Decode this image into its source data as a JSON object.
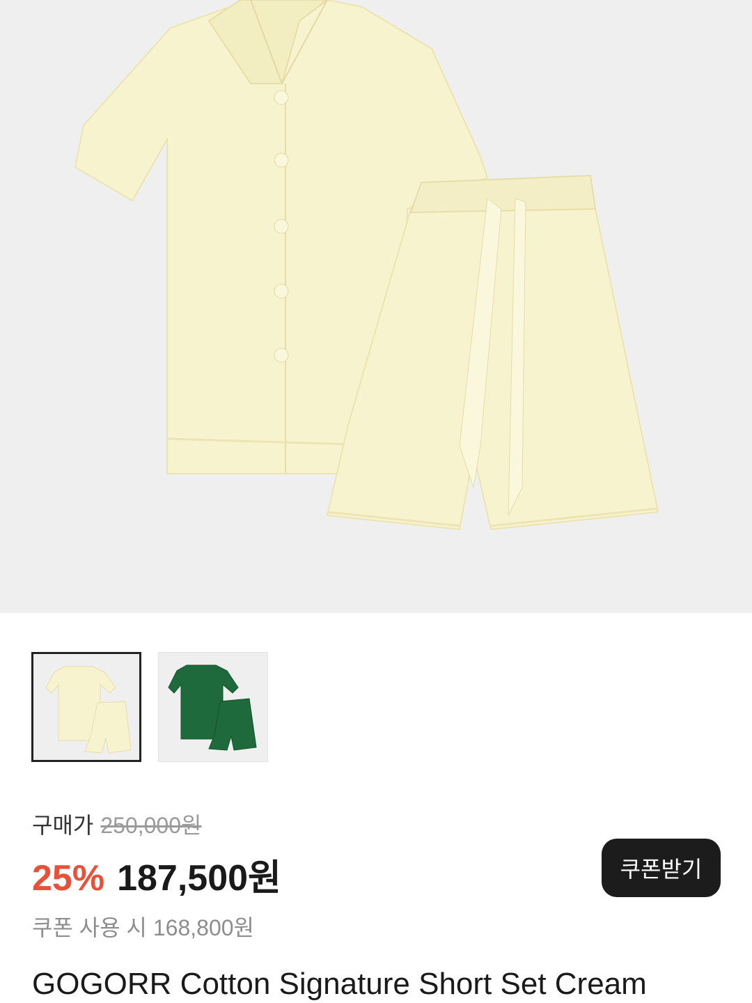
{
  "product": {
    "title": "GOGORR Cotton Signature Short Set Cream",
    "brand_mark": "GOGORR",
    "images": [
      {
        "name": "cream",
        "selected": true,
        "color": "#f8f3cf"
      },
      {
        "name": "green",
        "selected": false,
        "color": "#1e6a3c"
      }
    ]
  },
  "price": {
    "label": "구매가",
    "original": "250,000원",
    "discount": "25%",
    "sale": "187,500원",
    "coupon_text": "쿠폰 사용 시 168,800원"
  },
  "coupon_button": {
    "label": "쿠폰받기"
  },
  "colors": {
    "discount": "#e8503a",
    "button_bg": "#1c1c1c",
    "hero_bg": "#efefef"
  }
}
